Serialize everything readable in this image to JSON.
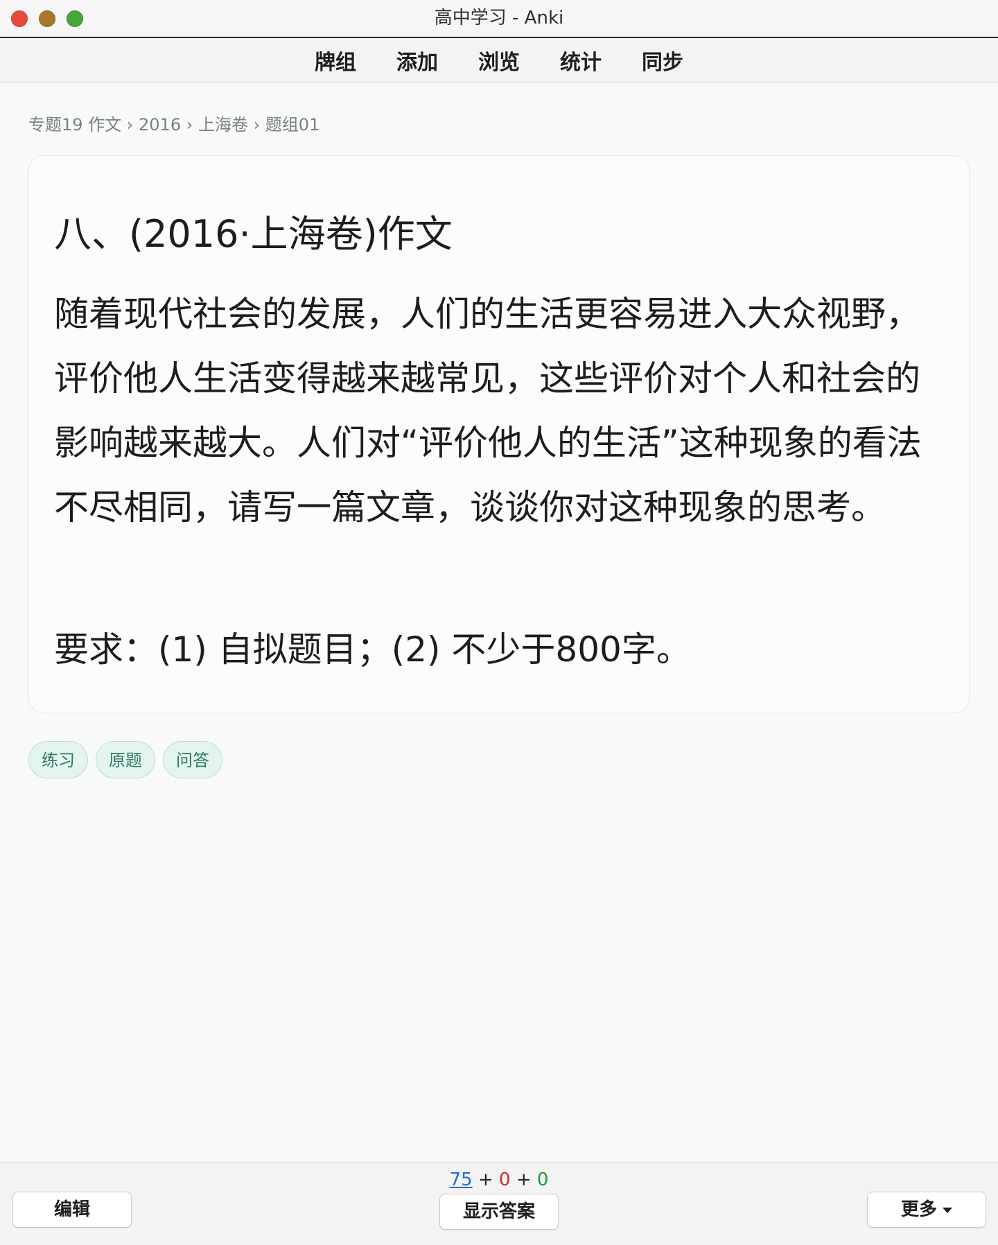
{
  "window": {
    "title": "高中学习 - Anki"
  },
  "nav": {
    "items": [
      "牌组",
      "添加",
      "浏览",
      "统计",
      "同步"
    ]
  },
  "breadcrumb": "专题19 作文 › 2016 › 上海卷 › 题组01",
  "card": {
    "heading": "八、(2016·上海卷)作文",
    "body": "随着现代社会的发展，人们的生活更容易进入大众视野，评价他人生活变得越来越常见，这些评价对个人和社会的影响越来越大。人们对“评价他人的生活”这种现象的看法不尽相同，请写一篇文章，谈谈你对这种现象的思考。",
    "requirement": "要求：(1) 自拟题目；(2) 不少于800字。"
  },
  "tags": [
    "练习",
    "原题",
    "问答"
  ],
  "counts": {
    "new": "75",
    "learn": "0",
    "review": "0",
    "plus": "+"
  },
  "buttons": {
    "edit": "编辑",
    "show_answer": "显示答案",
    "more": "更多"
  },
  "colors": {
    "count_new": "#2a6ad6",
    "count_learn": "#d62a2a",
    "count_review": "#1d9a3c",
    "tag_bg": "#e4f4ee",
    "tag_text": "#2d7a5a"
  }
}
